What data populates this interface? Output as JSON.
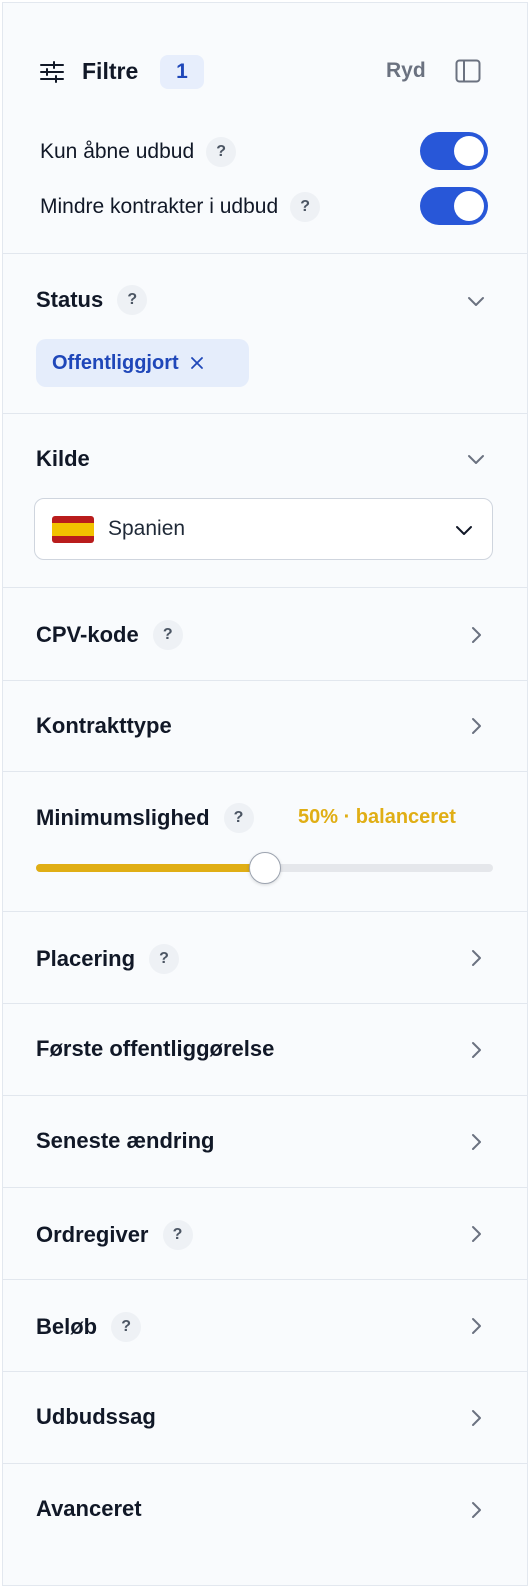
{
  "header": {
    "title": "Filtre",
    "count": "1",
    "clear_label": "Ryd",
    "filter_icon": "sliders-icon",
    "panel_icon": "sidebar-toggle-icon"
  },
  "toggles": [
    {
      "label": "Kun åbne udbud",
      "help": "?",
      "on": true
    },
    {
      "label": "Mindre kontrakter i udbud",
      "help": "?",
      "on": true
    }
  ],
  "status": {
    "title": "Status",
    "help": "?",
    "chip_label": "Offentliggjort"
  },
  "source": {
    "title": "Kilde",
    "selected": "Spanien",
    "flag_icon": "spain-flag-icon"
  },
  "cpv": {
    "title": "CPV-kode",
    "help": "?"
  },
  "contract_type": {
    "title": "Kontrakttype"
  },
  "similarity": {
    "title": "Minimumslighed",
    "help": "?",
    "value_label": "50% · balanceret",
    "value_percent": 50
  },
  "rows": [
    {
      "title": "Placering",
      "help": "?"
    },
    {
      "title": "Første offentliggørelse",
      "help": ""
    },
    {
      "title": "Seneste ændring",
      "help": ""
    },
    {
      "title": "Ordregiver",
      "help": "?"
    },
    {
      "title": "Beløb",
      "help": "?"
    },
    {
      "title": "Udbudssag",
      "help": ""
    },
    {
      "title": "Avanceret",
      "help": ""
    }
  ],
  "colors": {
    "accent": "#2857d8",
    "chip_bg": "#e5edfb",
    "chip_text": "#1f47b9",
    "slider": "#e0ae15"
  }
}
